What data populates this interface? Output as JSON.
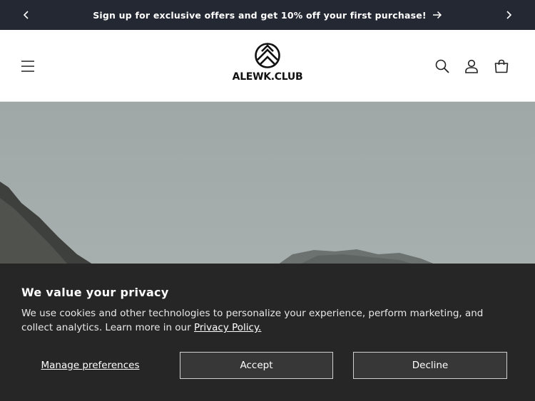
{
  "announcement": {
    "text": "Sign up for exclusive offers and get 10% off your first purchase!",
    "prev_icon": "chevron-left-icon",
    "next_icon": "chevron-right-icon",
    "arrow_icon": "arrow-right-icon"
  },
  "header": {
    "logo_text": "ALEWK.CLUB",
    "icons": [
      "menu-icon",
      "search-icon",
      "account-icon",
      "cart-icon"
    ]
  },
  "cookie_banner": {
    "title": "We value your privacy",
    "body": "We use cookies and other technologies to personalize your experience, perform marketing, and collect analytics. Learn more in our ",
    "policy_link": "Privacy Policy.",
    "manage_label": "Manage preferences",
    "accept_label": "Accept",
    "decline_label": "Decline"
  },
  "colors": {
    "announcement_bg": "#232833",
    "banner_bg": "#262626",
    "button_bg": "#373737"
  }
}
